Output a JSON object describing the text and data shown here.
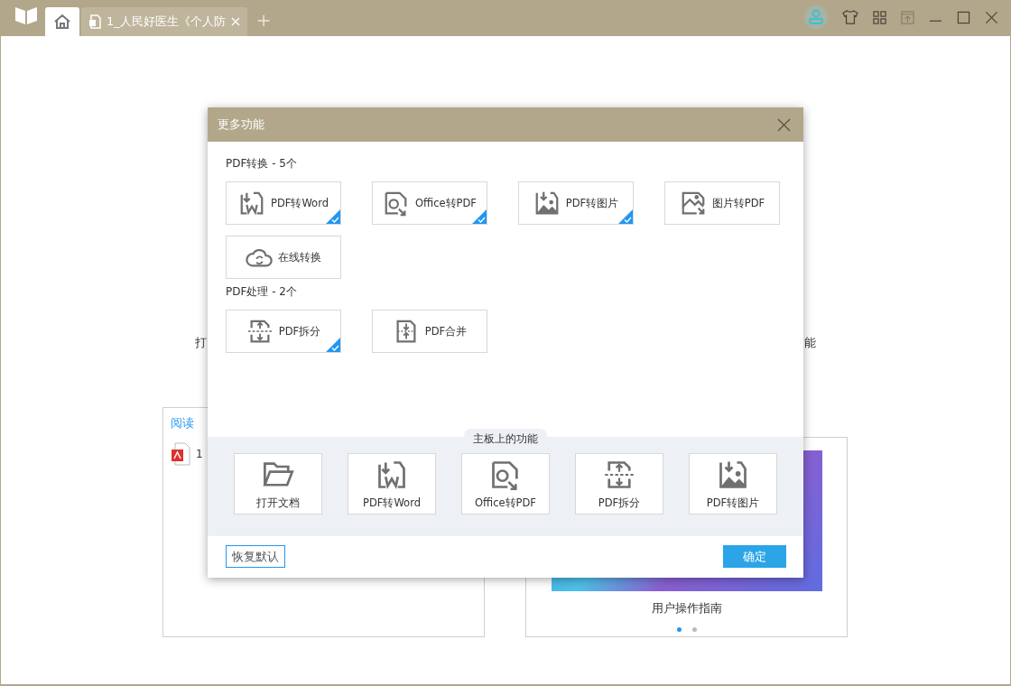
{
  "titlebar": {
    "tabs": [
      {
        "kind": "home",
        "selected": true
      },
      {
        "kind": "doc",
        "label": "1_人民好医生《个人防",
        "selected": false
      }
    ],
    "new_tab": "+"
  },
  "background": {
    "left_text": "打",
    "right_text": "能",
    "recent_card": {
      "title": "阅读",
      "file_number": "1"
    },
    "guide_card": {
      "caption": "用户操作指南",
      "dots": [
        {
          "selected": true
        },
        {
          "selected": false
        }
      ]
    }
  },
  "dialog": {
    "title": "更多功能",
    "sections": [
      {
        "title": "PDF转换 - 5个",
        "items": [
          {
            "label": "PDF转Word",
            "kind": "to-word",
            "checked": true
          },
          {
            "label": "Office转PDF",
            "kind": "office",
            "checked": true
          },
          {
            "label": "PDF转图片",
            "kind": "to-image",
            "checked": true
          },
          {
            "label": "图片转PDF",
            "kind": "image-to-pdf",
            "checked": false
          },
          {
            "label": "在线转换",
            "kind": "online",
            "checked": false
          }
        ]
      },
      {
        "title": "PDF处理 - 2个",
        "items": [
          {
            "label": "PDF拆分",
            "kind": "split",
            "checked": true
          },
          {
            "label": "PDF合并",
            "kind": "merge",
            "checked": false
          }
        ]
      }
    ],
    "board": {
      "title": "主板上的功能",
      "items": [
        {
          "label": "打开文档",
          "kind": "folder"
        },
        {
          "label": "PDF转Word",
          "kind": "to-word"
        },
        {
          "label": "Office转PDF",
          "kind": "office"
        },
        {
          "label": "PDF拆分",
          "kind": "split"
        },
        {
          "label": "PDF转图片",
          "kind": "to-image"
        }
      ]
    },
    "reset_button": "恢复默认",
    "ok_button": "确定"
  }
}
